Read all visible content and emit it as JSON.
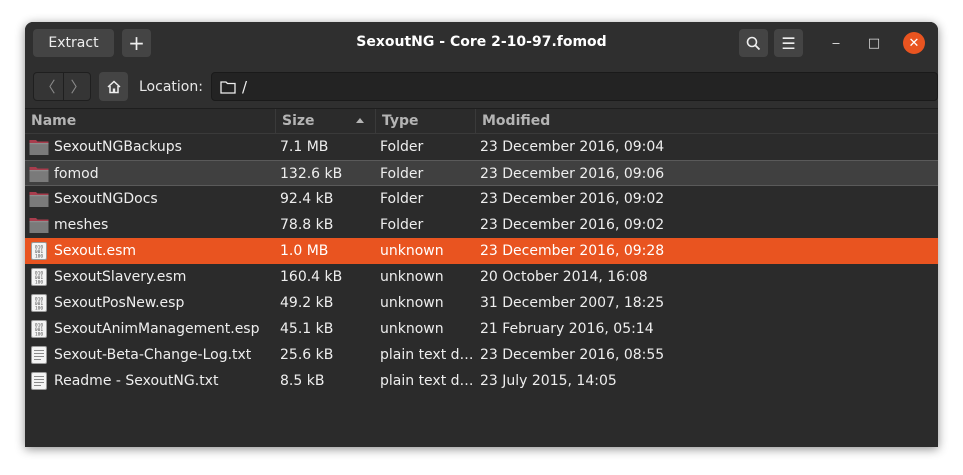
{
  "window": {
    "title": "SexoutNG - Core 2-10-97.fomod",
    "extract_label": "Extract",
    "add_label": "+",
    "menu_label": "☰",
    "min_label": "‒",
    "max_label": "□",
    "close_label": "✕"
  },
  "toolbar": {
    "back_label": "〈",
    "forward_label": "〉",
    "location_label": "Location:",
    "location_path": "/"
  },
  "columns": {
    "name": "Name",
    "size": "Size",
    "type": "Type",
    "modified": "Modified"
  },
  "files": [
    {
      "name": "SexoutNGBackups",
      "size": "7.1 MB",
      "type": "Folder",
      "modified": "23 December 2016, 09:04",
      "icon": "folder-icon"
    },
    {
      "name": "fomod",
      "size": "132.6 kB",
      "type": "Folder",
      "modified": "23 December 2016, 09:06",
      "icon": "folder-icon"
    },
    {
      "name": "SexoutNGDocs",
      "size": "92.4 kB",
      "type": "Folder",
      "modified": "23 December 2016, 09:02",
      "icon": "folder-icon"
    },
    {
      "name": "meshes",
      "size": "78.8 kB",
      "type": "Folder",
      "modified": "23 December 2016, 09:02",
      "icon": "folder-icon"
    },
    {
      "name": "Sexout.esm",
      "size": "1.0 MB",
      "type": "unknown",
      "modified": "23 December 2016, 09:28",
      "icon": "binary-file-icon"
    },
    {
      "name": "SexoutSlavery.esm",
      "size": "160.4 kB",
      "type": "unknown",
      "modified": "20 October 2014, 16:08",
      "icon": "binary-file-icon"
    },
    {
      "name": "SexoutPosNew.esp",
      "size": "49.2 kB",
      "type": "unknown",
      "modified": "31 December 2007, 18:25",
      "icon": "binary-file-icon"
    },
    {
      "name": "SexoutAnimManagement.esp",
      "size": "45.1 kB",
      "type": "unknown",
      "modified": "21 February 2016, 05:14",
      "icon": "binary-file-icon"
    },
    {
      "name": "Sexout-Beta-Change-Log.txt",
      "size": "25.6 kB",
      "type": "plain text d…",
      "modified": "23 December 2016, 08:55",
      "icon": "text-file-icon"
    },
    {
      "name": "Readme - SexoutNG.txt",
      "size": "8.5 kB",
      "type": "plain text d…",
      "modified": "23 July 2015, 14:05",
      "icon": "text-file-icon"
    }
  ],
  "colors": {
    "accent": "#e95420",
    "background": "#2b2b2b"
  }
}
